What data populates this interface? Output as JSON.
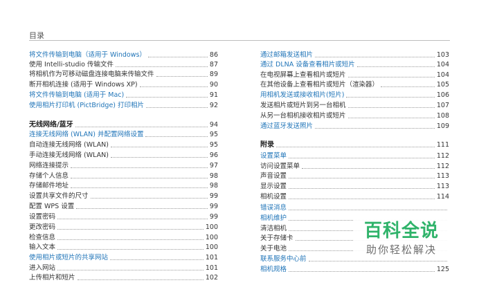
{
  "header": {
    "title": "目录"
  },
  "left_column": [
    {
      "text": "将文件传输到电脑（适用于 Windows）",
      "page": "86",
      "style": "blue"
    },
    {
      "text": "使用 Intelli-studio 传输文件",
      "page": "87",
      "style": "normal"
    },
    {
      "text": "将相机作为可移动磁盘连接电脑来传输文件",
      "page": "89",
      "style": "normal"
    },
    {
      "text": "断开相机连接 (适用于 Windows XP)",
      "page": "90",
      "style": "normal"
    },
    {
      "text": "将文件传输到电脑 (适用于 Mac)",
      "page": "91",
      "style": "blue"
    },
    {
      "text": "使用相片打印机 (PictBridge) 打印相片",
      "page": "92",
      "style": "blue"
    },
    {
      "text": "无线网络/蓝牙",
      "page": "94",
      "style": "section"
    },
    {
      "text": "连接无线网络 (WLAN) 并配置网络设置",
      "page": "95",
      "style": "blue"
    },
    {
      "text": "自动连接无线网络 (WLAN)",
      "page": "95",
      "style": "normal"
    },
    {
      "text": "手动连接无线网络 (WLAN)",
      "page": "96",
      "style": "normal"
    },
    {
      "text": "网络连接提示",
      "page": "97",
      "style": "normal"
    },
    {
      "text": "存储个人信息",
      "page": "98",
      "style": "normal"
    },
    {
      "text": "存储邮件地址",
      "page": "98",
      "style": "normal"
    },
    {
      "text": "设置共享文件的尺寸",
      "page": "99",
      "style": "normal"
    },
    {
      "text": "配置 WPS 设置",
      "page": "99",
      "style": "normal"
    },
    {
      "text": "设置密码",
      "page": "99",
      "style": "normal"
    },
    {
      "text": "更改密码",
      "page": "100",
      "style": "normal"
    },
    {
      "text": "检查信息",
      "page": "100",
      "style": "normal"
    },
    {
      "text": "输入文本",
      "page": "100",
      "style": "normal"
    },
    {
      "text": "使用相片或短片的共享网站",
      "page": "101",
      "style": "blue"
    },
    {
      "text": "进入网站",
      "page": "101",
      "style": "normal"
    },
    {
      "text": "上传相片和短片",
      "page": "102",
      "style": "normal"
    }
  ],
  "right_column": [
    {
      "text": "通过邮箱发送相片",
      "page": "103",
      "style": "blue"
    },
    {
      "text": "通过 DLNA 设备查看相片或短片",
      "page": "104",
      "style": "blue"
    },
    {
      "text": "在电视屏幕上查看相片或短片",
      "page": "104",
      "style": "normal"
    },
    {
      "text": "在其他设备上查看相片或短片（渲染器）",
      "page": "105",
      "style": "normal"
    },
    {
      "text": "用相机发送或接收相片(短片)",
      "page": "106",
      "style": "blue"
    },
    {
      "text": "发送相片或短片到另一台相机",
      "page": "107",
      "style": "normal"
    },
    {
      "text": "从另一台相机接收相片或短片",
      "page": "108",
      "style": "normal"
    },
    {
      "text": "通过蓝牙发送照片",
      "page": "109",
      "style": "blue"
    },
    {
      "text": "附录",
      "page": "111",
      "style": "section"
    },
    {
      "text": "设置菜单",
      "page": "112",
      "style": "blue"
    },
    {
      "text": "访问设置菜单",
      "page": "112",
      "style": "normal"
    },
    {
      "text": "声音设置",
      "page": "113",
      "style": "normal"
    },
    {
      "text": "显示设置",
      "page": "113",
      "style": "normal"
    },
    {
      "text": "相机设置",
      "page": "114",
      "style": "normal"
    },
    {
      "text": "错误消息",
      "page": "",
      "style": "blue"
    },
    {
      "text": "相机维护",
      "page": "",
      "style": "blue"
    },
    {
      "text": "清洁相机",
      "page": "",
      "style": "normal"
    },
    {
      "text": "关于存储卡",
      "page": "",
      "style": "normal"
    },
    {
      "text": "关于电池",
      "page": "",
      "style": "normal"
    },
    {
      "text": "联系服务中心前",
      "page": "",
      "style": "blue"
    },
    {
      "text": "相机规格",
      "page": "125",
      "style": "blue"
    }
  ],
  "watermark": {
    "main": "百科全说",
    "sub": "助你轻松解决"
  },
  "colors": {
    "link_blue": "#1f74b8",
    "text": "#333333",
    "watermark_green": "#2fb36a"
  }
}
